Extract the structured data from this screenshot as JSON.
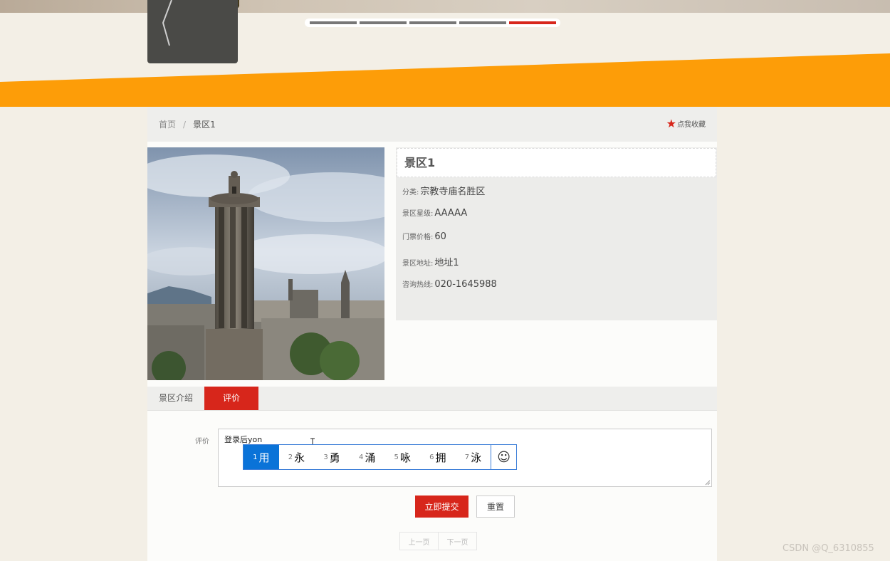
{
  "breadcrumb": {
    "home": "首页",
    "separator": "/",
    "current": "景区1"
  },
  "favorite": {
    "icon": "star-icon",
    "label": "点我收藏"
  },
  "slider": {
    "dots": 5,
    "active_index": 4
  },
  "scenic": {
    "title": "景区1",
    "fields": [
      {
        "label": "分类:",
        "value": "宗教寺庙名胜区"
      },
      {
        "label": "景区星级:",
        "value": "AAAAA"
      },
      {
        "label": "门票价格:",
        "value": "60"
      },
      {
        "label": "景区地址:",
        "value": "地址1"
      },
      {
        "label": "咨询热线:",
        "value": "020-1645988"
      }
    ]
  },
  "tabs": [
    {
      "label": "景区介绍",
      "active": false
    },
    {
      "label": "评价",
      "active": true
    }
  ],
  "comment_form": {
    "label": "评价",
    "value": "登录后yon",
    "submit_label": "立即提交",
    "reset_label": "重置"
  },
  "ime": {
    "candidates": [
      {
        "num": "1",
        "char": "用"
      },
      {
        "num": "2",
        "char": "永"
      },
      {
        "num": "3",
        "char": "勇"
      },
      {
        "num": "4",
        "char": "涌"
      },
      {
        "num": "5",
        "char": "咏"
      },
      {
        "num": "6",
        "char": "拥"
      },
      {
        "num": "7",
        "char": "泳"
      }
    ],
    "selected_index": 0,
    "emoji_icon": "smiley-icon",
    "emoji_glyph": "☺"
  },
  "pagination": {
    "prev_label": "上一页",
    "next_label": "下一页"
  },
  "watermark": "CSDN @Q_6310855",
  "colors": {
    "accent_red": "#d7261b",
    "band_orange": "#fd9d08",
    "ime_blue": "#0a73d8"
  }
}
